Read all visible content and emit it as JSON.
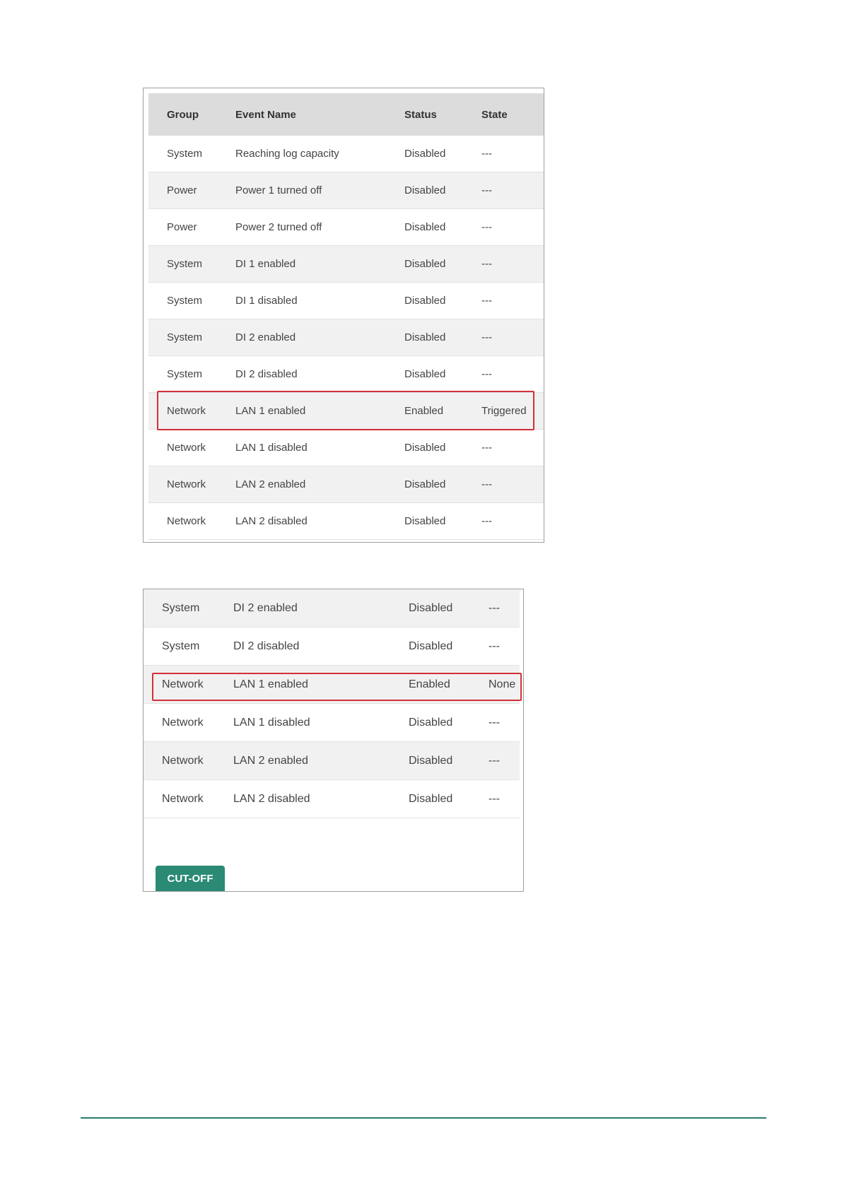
{
  "panel_top": {
    "headers": [
      "Group",
      "Event Name",
      "Status",
      "State"
    ],
    "rows": [
      {
        "group": "System",
        "event": "Reaching log capacity",
        "status": "Disabled",
        "state": "---"
      },
      {
        "group": "Power",
        "event": "Power 1 turned off",
        "status": "Disabled",
        "state": "---"
      },
      {
        "group": "Power",
        "event": "Power 2 turned off",
        "status": "Disabled",
        "state": "---"
      },
      {
        "group": "System",
        "event": "DI 1 enabled",
        "status": "Disabled",
        "state": "---"
      },
      {
        "group": "System",
        "event": "DI 1 disabled",
        "status": "Disabled",
        "state": "---"
      },
      {
        "group": "System",
        "event": "DI 2 enabled",
        "status": "Disabled",
        "state": "---"
      },
      {
        "group": "System",
        "event": "DI 2 disabled",
        "status": "Disabled",
        "state": "---"
      },
      {
        "group": "Network",
        "event": "LAN 1 enabled",
        "status": "Enabled",
        "state": "Triggered"
      },
      {
        "group": "Network",
        "event": "LAN 1 disabled",
        "status": "Disabled",
        "state": "---"
      },
      {
        "group": "Network",
        "event": "LAN 2 enabled",
        "status": "Disabled",
        "state": "---"
      },
      {
        "group": "Network",
        "event": "LAN 2 disabled",
        "status": "Disabled",
        "state": "---"
      }
    ]
  },
  "panel_bottom": {
    "rows": [
      {
        "group": "System",
        "event": "DI 2 enabled",
        "status": "Disabled",
        "state": "---"
      },
      {
        "group": "System",
        "event": "DI 2 disabled",
        "status": "Disabled",
        "state": "---"
      },
      {
        "group": "Network",
        "event": "LAN 1 enabled",
        "status": "Enabled",
        "state": "None"
      },
      {
        "group": "Network",
        "event": "LAN 1 disabled",
        "status": "Disabled",
        "state": "---"
      },
      {
        "group": "Network",
        "event": "LAN 2 enabled",
        "status": "Disabled",
        "state": "---"
      },
      {
        "group": "Network",
        "event": "LAN 2 disabled",
        "status": "Disabled",
        "state": "---"
      }
    ],
    "button_label": "CUT-OFF"
  },
  "colors": {
    "header_bg": "#dcdcdc",
    "alt_row_bg": "#f1f1f1",
    "highlight": "#d32f3a",
    "button_bg": "#2a8a74",
    "footer_line": "#2a7d6a"
  }
}
